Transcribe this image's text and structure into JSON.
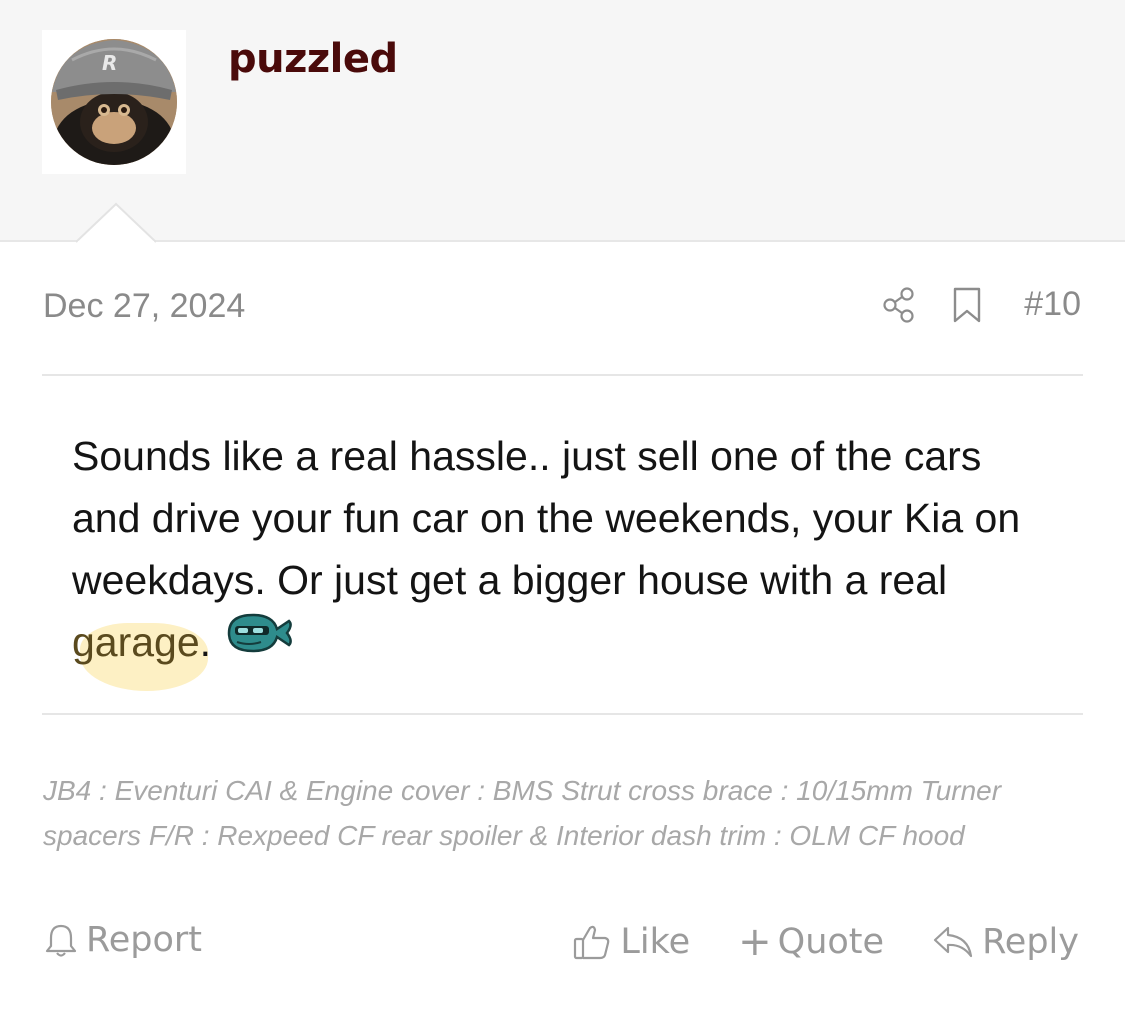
{
  "post": {
    "username": "puzzled",
    "date": "Dec 27, 2024",
    "post_number": "#10",
    "message_before": "Sounds like a real hassle.. just sell one of the cars and drive your fun car on the weekends, your Kia on weekdays. Or just get a bigger house with a real ",
    "message_highlight": "garage",
    "message_after": ".",
    "signature": "JB4 : Eventuri CAI & Engine cover : BMS Strut cross brace : 10/15mm Turner spacers F/R : Rexpeed CF rear spoiler & Interior dash trim : OLM CF hood"
  },
  "actions": {
    "report": "Report",
    "like": "Like",
    "quote": "Quote",
    "reply": "Reply"
  },
  "icons": {
    "avatar": "avatar-monkey-cap",
    "share": "share-icon",
    "bookmark": "bookmark-icon",
    "report": "bell-icon",
    "like": "thumbs-up-icon",
    "quote": "plus-icon",
    "reply": "reply-arrow-icon",
    "emoji": "whale-emoji-icon"
  },
  "colors": {
    "username": "#4a0a0a",
    "muted_text": "#8a8a8a",
    "highlight": "#fdf0c4",
    "header_bg": "#f6f6f6"
  }
}
